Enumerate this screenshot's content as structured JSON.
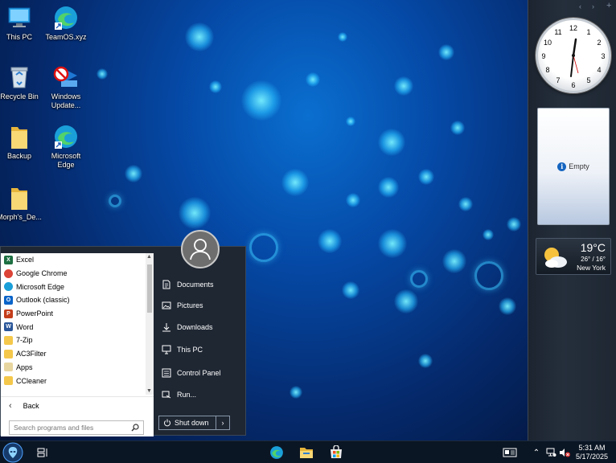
{
  "desktop": {
    "icons": [
      {
        "label": "This PC"
      },
      {
        "label": "TeamOS.xyz"
      },
      {
        "label": "Recycle Bin"
      },
      {
        "label": "Windows Update..."
      },
      {
        "label": "Backup"
      },
      {
        "label": "Microsoft Edge"
      },
      {
        "label": "Morph's_De..."
      }
    ]
  },
  "gadgets": {
    "controls": [
      "‹",
      "›",
      "+"
    ],
    "clock": {
      "numbers": [
        "12",
        "1",
        "2",
        "3",
        "4",
        "5",
        "6",
        "7",
        "8",
        "9",
        "10",
        "11"
      ]
    },
    "slideshow": {
      "label": "Empty"
    },
    "weather": {
      "temp": "19°C",
      "range": "26° / 16°",
      "city": "New York"
    }
  },
  "start_menu": {
    "programs": [
      {
        "label": "Excel",
        "icon": "excel-icon",
        "color": "#1d6f42",
        "glyph": "X"
      },
      {
        "label": "Google Chrome",
        "icon": "chrome-icon",
        "color": "#db4437",
        "glyph": ""
      },
      {
        "label": "Microsoft Edge",
        "icon": "edge-icon",
        "color": "#1a9fd9",
        "glyph": ""
      },
      {
        "label": "Outlook (classic)",
        "icon": "outlook-icon",
        "color": "#0a64c9",
        "glyph": "O"
      },
      {
        "label": "PowerPoint",
        "icon": "powerpoint-icon",
        "color": "#c43e1c",
        "glyph": "P"
      },
      {
        "label": "Word",
        "icon": "word-icon",
        "color": "#2b579a",
        "glyph": "W"
      },
      {
        "label": "7-Zip",
        "icon": "folder-icon",
        "color": "#f5c84c",
        "glyph": ""
      },
      {
        "label": "AC3Filter",
        "icon": "folder-icon",
        "color": "#f5c84c",
        "glyph": ""
      },
      {
        "label": "Apps",
        "icon": "apps-folder-icon",
        "color": "#e8d6a0",
        "glyph": ""
      },
      {
        "label": "CCleaner",
        "icon": "folder-icon",
        "color": "#f5c84c",
        "glyph": ""
      }
    ],
    "back_label": "Back",
    "search_placeholder": "Search programs and files",
    "places": [
      {
        "label": "Documents",
        "icon": "document-icon"
      },
      {
        "label": "Pictures",
        "icon": "picture-icon"
      },
      {
        "label": "Downloads",
        "icon": "download-icon"
      },
      {
        "label": "This PC",
        "icon": "monitor-icon"
      },
      {
        "label": "Control Panel",
        "icon": "control-panel-icon"
      },
      {
        "label": "Run...",
        "icon": "run-icon"
      }
    ],
    "shutdown_label": "Shut down"
  },
  "taskbar": {
    "time": "5:31 AM",
    "date": "5/17/2025"
  }
}
